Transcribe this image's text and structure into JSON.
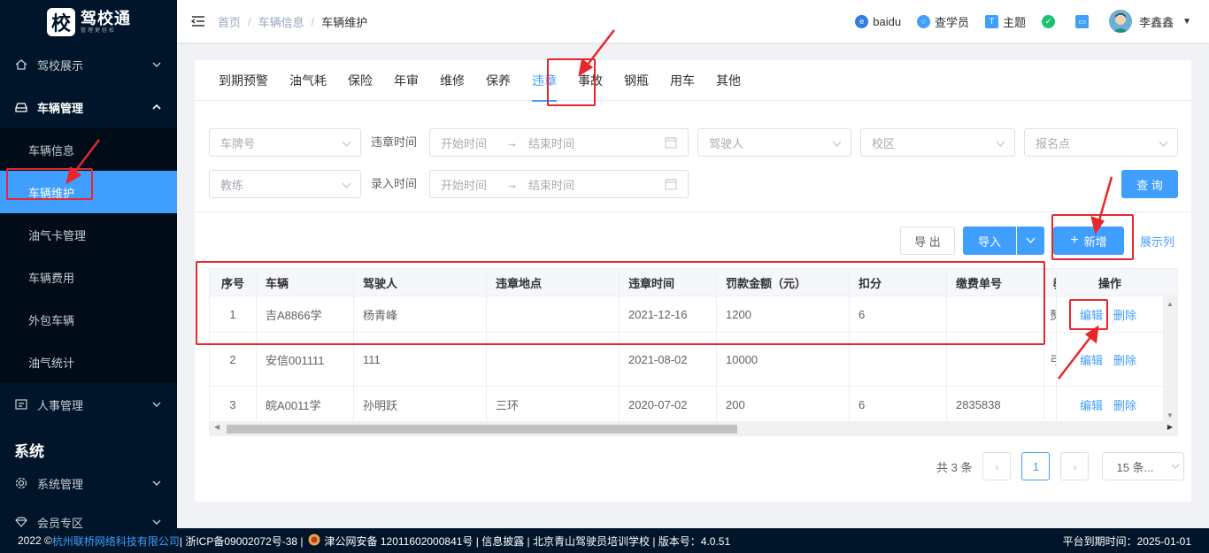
{
  "logo": {
    "char": "校",
    "title": "驾校通",
    "subtitle": "管理更轻松"
  },
  "sidebar": {
    "items": [
      {
        "label": "驾校展示"
      },
      {
        "label": "车辆管理"
      },
      {
        "label": "人事管理"
      }
    ],
    "sub_items": [
      "车辆信息",
      "车辆维护",
      "油气卡管理",
      "车辆费用",
      "外包车辆",
      "油气统计"
    ],
    "section_title": "系统",
    "system_items": [
      {
        "label": "系统管理"
      },
      {
        "label": "会员专区"
      }
    ]
  },
  "breadcrumb": [
    "首页",
    "车辆信息",
    "车辆维护"
  ],
  "topbar": {
    "baidu": "baidu",
    "student": "查学员",
    "theme": "主题",
    "user": "李鑫鑫"
  },
  "tabs": [
    "到期预警",
    "油气耗",
    "保险",
    "年审",
    "维修",
    "保养",
    "违章",
    "事故",
    "钢瓶",
    "用车",
    "其他"
  ],
  "active_tab": "违章",
  "filters": {
    "plate_placeholder": "车牌号",
    "violation_time_label": "违章时间",
    "start_placeholder": "开始时间",
    "end_placeholder": "结束时间",
    "driver_placeholder": "驾驶人",
    "campus_placeholder": "校区",
    "signup_placeholder": "报名点",
    "coach_placeholder": "教练",
    "entry_time_label": "录入时间",
    "entry_start_placeholder": "开始时间",
    "entry_end_placeholder": "结束时间",
    "range_sep": "→"
  },
  "buttons": {
    "query": "查 询",
    "export": "导 出",
    "import": "导入",
    "add": "新增",
    "show_cols": "展示列"
  },
  "table": {
    "headers": [
      "序号",
      "车辆",
      "驾驶人",
      "违章地点",
      "违章时间",
      "罚款金额（元）",
      "扣分",
      "缴费单号",
      "",
      "操作"
    ],
    "rows": [
      {
        "idx": "1",
        "vehicle": "吉A8866学",
        "driver": "杨青峰",
        "place": "",
        "time": "2021-12-16",
        "fine": "1200",
        "points": "6",
        "bill": "",
        "extra": "赘"
      },
      {
        "idx": "2",
        "vehicle": "安信001111",
        "driver": "111",
        "place": "",
        "time": "2021-08-02",
        "fine": "10000",
        "points": "",
        "bill": "",
        "extra": "弓"
      },
      {
        "idx": "3",
        "vehicle": "皖A0011学",
        "driver": "孙明跃",
        "place": "三环",
        "time": "2020-07-02",
        "fine": "200",
        "points": "6",
        "bill": "2835838",
        "extra": ""
      }
    ],
    "edit": "编辑",
    "delete": "删除"
  },
  "pagination": {
    "total": "共 3 条",
    "page": "1",
    "page_size": "15 条..."
  },
  "footer": {
    "year": "2022 ©",
    "company": "杭州联桥网络科技有限公司",
    "icp": " | 浙ICP备09002072号-38 | ",
    "police": "津公网安备 12011602000841号 | 信息披露 | 北京青山驾驶员培训学校 | 版本号：4.0.51",
    "expire": "平台到期时间：2025-01-01"
  }
}
